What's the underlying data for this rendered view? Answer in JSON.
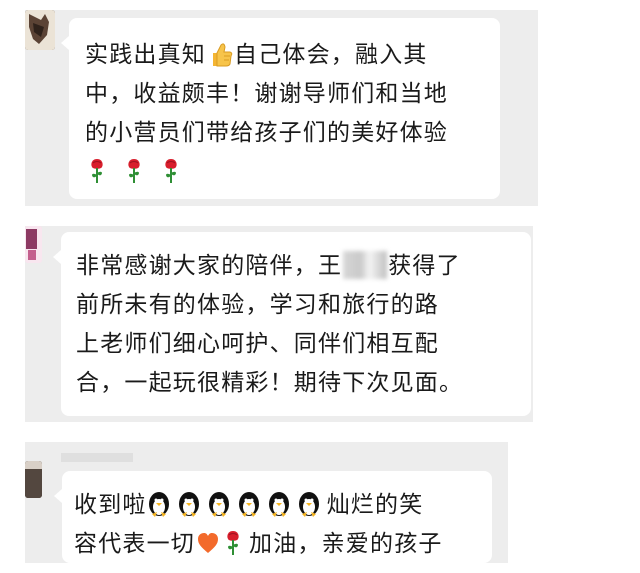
{
  "messages": [
    {
      "lines": [
        "实践出真知",
        "自己体会，融入其",
        "中，收益颇丰！谢谢导师们和当地",
        "的小营员们带给孩子们的美好体验"
      ],
      "emoji": [
        "thumbs-up",
        "rose",
        "rose",
        "rose"
      ]
    },
    {
      "lines": [
        "非常感谢大家的陪伴，王",
        "获得了",
        "前所未有的体验，学习和旅行的路",
        "上老师们细心呵护、同伴们相互配",
        "合，一起玩很精彩！期待下次见面。"
      ],
      "emoji": [
        "blurred-name"
      ]
    },
    {
      "lines": [
        "收到啦",
        "灿烂的笑",
        "容代表一切",
        "加油，亲爱的孩子"
      ],
      "emoji": [
        "penguin",
        "penguin",
        "penguin",
        "penguin",
        "penguin",
        "penguin",
        "heart",
        "rose"
      ]
    }
  ],
  "colors": {
    "chat_background": "#ededed",
    "bubble": "#ffffff",
    "text": "#1a1a1a",
    "rose_red": "#d81e2c",
    "leaf_green": "#2f8f35",
    "heart_orange": "#f36a2b"
  }
}
